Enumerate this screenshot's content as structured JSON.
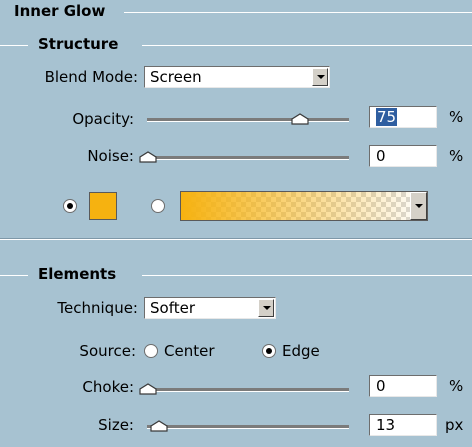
{
  "panel": {
    "title": "Inner Glow",
    "structure": {
      "heading": "Structure",
      "blend_mode_label": "Blend Mode:",
      "blend_mode_value": "Screen",
      "opacity_label": "Opacity:",
      "opacity_value": "75",
      "opacity_unit": "%",
      "opacity_level": 0.75,
      "noise_label": "Noise:",
      "noise_value": "0",
      "noise_unit": "%",
      "noise_level": 0.0,
      "color_mode": "solid",
      "glow_color": "#f6b210"
    },
    "elements": {
      "heading": "Elements",
      "technique_label": "Technique:",
      "technique_value": "Softer",
      "source_label": "Source:",
      "source_options": [
        "Center",
        "Edge"
      ],
      "source_selected": "Edge",
      "choke_label": "Choke:",
      "choke_value": "0",
      "choke_unit": "%",
      "choke_level": 0.0,
      "size_label": "Size:",
      "size_value": "13",
      "size_unit": "px",
      "size_level": 0.052
    }
  }
}
